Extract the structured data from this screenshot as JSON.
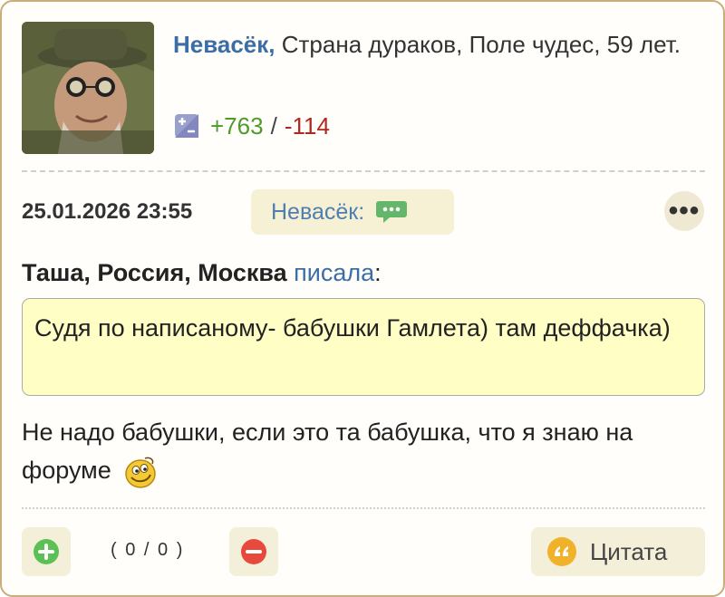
{
  "author": {
    "name": "Невасёк,",
    "details": "Страна дураков, Поле чудес, 59 лет.",
    "rating_plus": "+763",
    "rating_sep": "/",
    "rating_minus": "-114"
  },
  "post": {
    "datetime": "25.01.2026 23:55",
    "reply_to_label": "Невасёк:",
    "more_label": "•••"
  },
  "quote": {
    "author": "Таша, Россия, Москва",
    "wrote": "писала",
    "colon": ":",
    "text": "Судя по написаному- бабушки Гамлета) там деффачка)"
  },
  "message": {
    "text": "Не надо бабушки, если это та бабушка, что я знаю на форуме"
  },
  "footer": {
    "vote_count": "( 0 / 0 )",
    "quote_button_label": "Цитата"
  },
  "colors": {
    "accent_blue": "#3b6ea5",
    "plus_green": "#4e9b2a",
    "minus_red": "#b3261e",
    "quote_bg": "#fffec4",
    "button_bg": "#f3efd8",
    "card_border": "#c9ad7a"
  }
}
